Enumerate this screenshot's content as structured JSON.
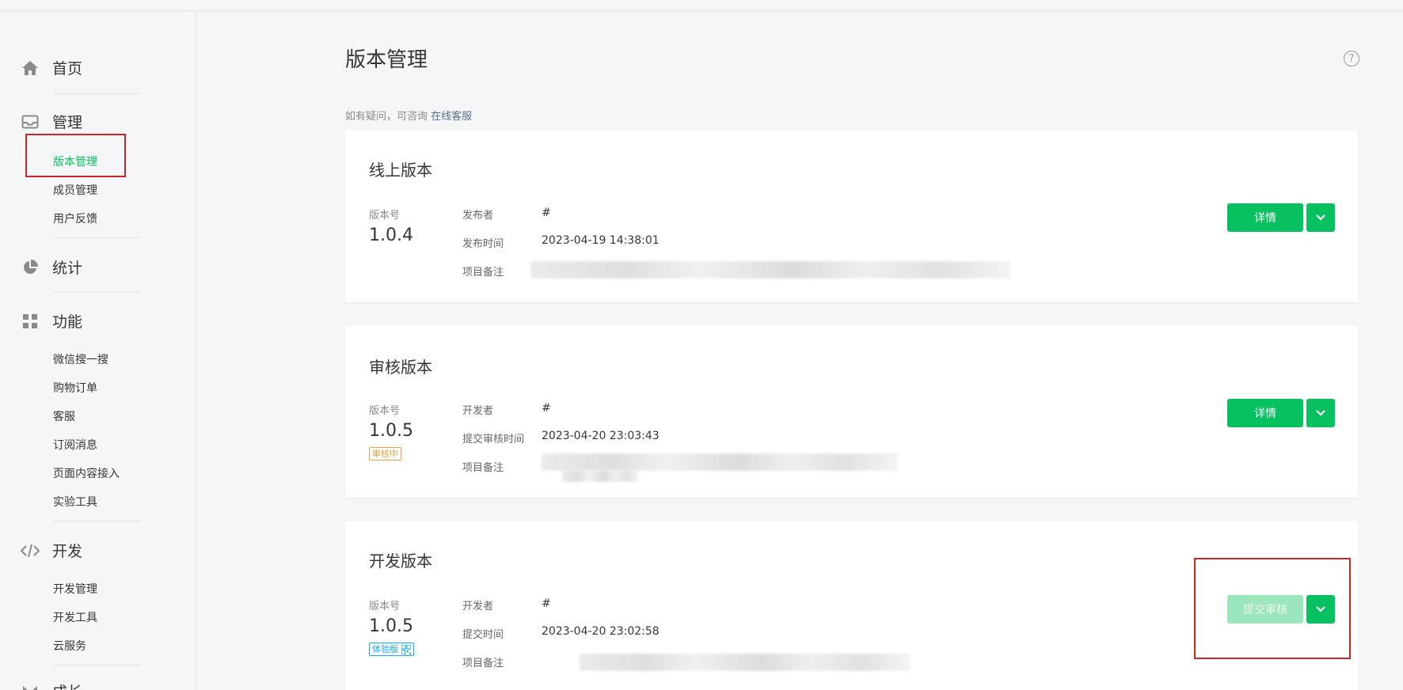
{
  "sidebar": {
    "home": "首页",
    "manage": "管理",
    "manage_items": [
      "版本管理",
      "成员管理",
      "用户反馈"
    ],
    "stats": "统计",
    "features": "功能",
    "feature_items": [
      "微信搜一搜",
      "购物订单",
      "客服",
      "订阅消息",
      "页面内容接入",
      "实验工具"
    ],
    "dev": "开发",
    "dev_items": [
      "开发管理",
      "开发工具",
      "云服务"
    ],
    "growth": "成长"
  },
  "main": {
    "title": "版本管理",
    "hint_prefix": "如有疑问，可咨询 ",
    "hint_link": "在线客服"
  },
  "cards": [
    {
      "title": "线上版本",
      "version_label": "版本号",
      "version": "1.0.4",
      "rows": [
        {
          "label": "发布者",
          "value": "#"
        },
        {
          "label": "发布时间",
          "value": "2023-04-19 14:38:01"
        },
        {
          "label": "项目备注",
          "value": ""
        }
      ],
      "primary_button": "详情"
    },
    {
      "title": "审核版本",
      "version_label": "版本号",
      "version": "1.0.5",
      "badge": "审核中",
      "rows": [
        {
          "label": "开发者",
          "value": "#"
        },
        {
          "label": "提交审核时间",
          "value": "2023-04-20 23:03:43"
        },
        {
          "label": "项目备注",
          "value": ""
        }
      ],
      "primary_button": "详情"
    },
    {
      "title": "开发版本",
      "version_label": "版本号",
      "version": "1.0.5",
      "badge": "体验版",
      "rows": [
        {
          "label": "开发者",
          "value": "#"
        },
        {
          "label": "提交时间",
          "value": "2023-04-20 23:02:58"
        },
        {
          "label": "项目备注",
          "value": ""
        }
      ],
      "primary_button": "提交审核"
    }
  ],
  "colors": {
    "accent": "#07c160",
    "link": "#576b95",
    "highlight_box": "#c9262c",
    "badge_review": "#fa9d3b",
    "badge_trial": "#10aeff"
  }
}
